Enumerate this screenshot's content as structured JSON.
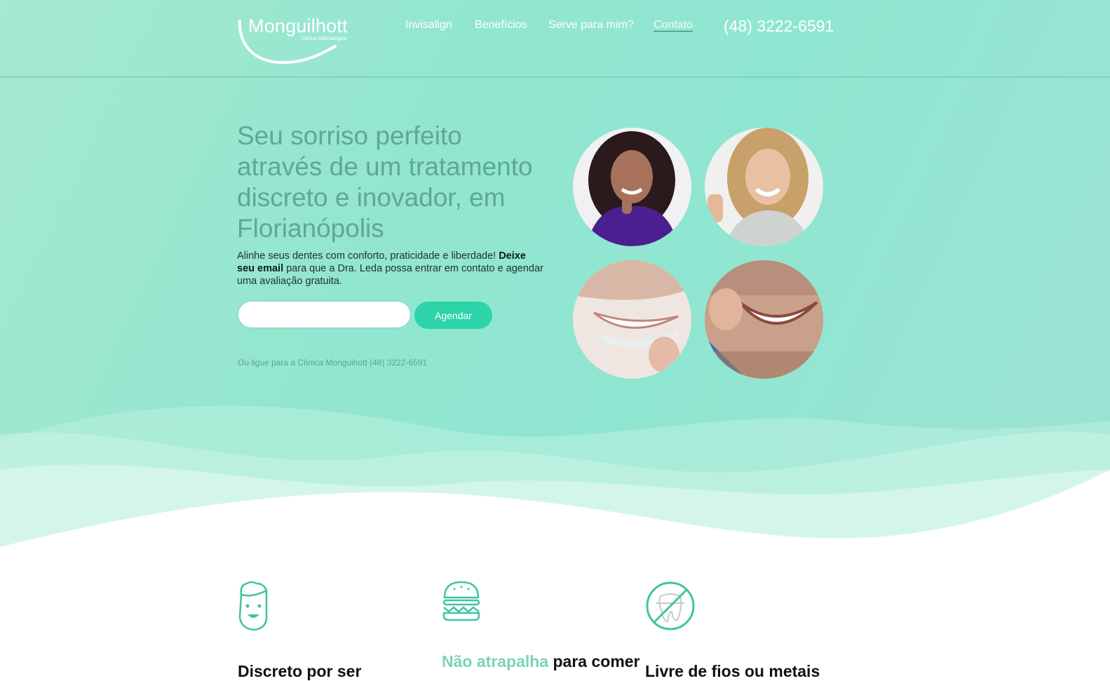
{
  "brand": {
    "name": "Monguilhott",
    "tagline": "Clínica Odontológica"
  },
  "nav": {
    "items": [
      {
        "label": "Invisalign"
      },
      {
        "label": "Benefícios"
      },
      {
        "label": "Serve para mim?"
      },
      {
        "label": "Contato",
        "active": true
      }
    ],
    "phone": "(48) 3222-6591"
  },
  "hero": {
    "headline": "Seu sorriso perfeito através de um tratamento discreto e inovador, em Florianópolis",
    "sub_part1": "Alinhe seus dentes com conforto, praticidade e liberdade! ",
    "sub_bold": "Deixe seu email",
    "sub_part2": " para que a Dra. Leda possa entrar em contato e agendar uma avaliação gratuita.",
    "email_value": "",
    "email_placeholder": "",
    "cta_label": "Agendar",
    "call_text": "Ou ligue para a Clínica Monguihott (48) 3222-6591"
  },
  "features": [
    {
      "icon": "smiling-face-icon",
      "title": "Discreto por ser",
      "accent": ""
    },
    {
      "icon": "burger-icon",
      "accent": "Não atrapalha",
      "title": " para comer"
    },
    {
      "icon": "no-wires-tooth-icon",
      "title": "Livre de fios ou metais",
      "accent": ""
    }
  ],
  "colors": {
    "accent": "#2dd3a9",
    "headline": "#5fa892",
    "hero_bg": "#92e6cf",
    "feature_accent": "#7bd3b5"
  }
}
